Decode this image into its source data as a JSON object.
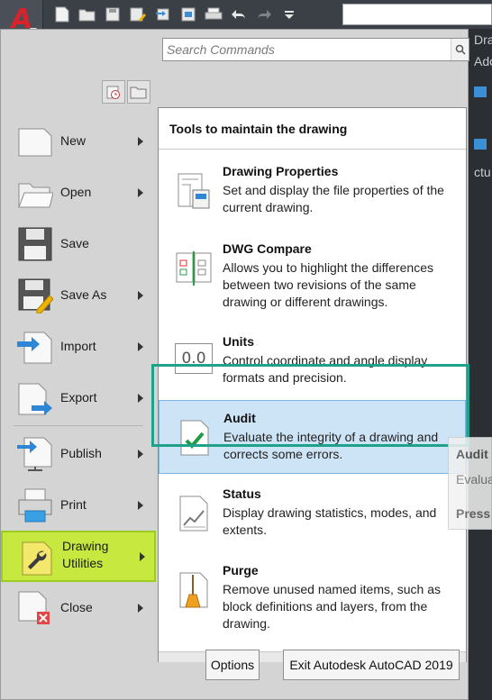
{
  "search": {
    "placeholder": "Search Commands"
  },
  "quick_access": {
    "icons": [
      "new-icon",
      "open-icon",
      "save-icon",
      "save-as-icon",
      "publish-icon",
      "plot-icon",
      "print-icon",
      "undo-icon",
      "redo-icon",
      "customize-icon"
    ]
  },
  "background": {
    "fragments": [
      "Dra",
      "Ado",
      "ctu"
    ]
  },
  "left_menu": [
    {
      "id": "new",
      "label": "New",
      "has_submenu": true,
      "icon": "new-file-icon"
    },
    {
      "id": "open",
      "label": "Open",
      "has_submenu": true,
      "icon": "open-folder-icon"
    },
    {
      "id": "save",
      "label": "Save",
      "has_submenu": false,
      "icon": "save-icon"
    },
    {
      "id": "save-as",
      "label": "Save As",
      "has_submenu": true,
      "icon": "save-as-icon"
    },
    {
      "id": "import",
      "label": "Import",
      "has_submenu": true,
      "icon": "import-icon"
    },
    {
      "id": "export",
      "label": "Export",
      "has_submenu": true,
      "icon": "export-icon"
    },
    {
      "id": "publish",
      "label": "Publish",
      "has_submenu": true,
      "icon": "publish-icon"
    },
    {
      "id": "print",
      "label": "Print",
      "has_submenu": true,
      "icon": "print-icon"
    },
    {
      "id": "drawing-utilities",
      "label_line1": "Drawing",
      "label_line2": "Utilities",
      "has_submenu": true,
      "icon": "wrench-icon",
      "active": true
    },
    {
      "id": "close",
      "label": "Close",
      "has_submenu": true,
      "icon": "close-file-icon"
    }
  ],
  "flyout": {
    "title": "Tools to maintain the drawing",
    "items": [
      {
        "name": "Drawing Properties",
        "desc": "Set and display the file properties of the current drawing.",
        "icon": "drawing-properties-icon"
      },
      {
        "name": "DWG Compare",
        "desc": "Allows you to highlight the differences between two revisions of the same drawing or different drawings.",
        "icon": "dwg-compare-icon"
      },
      {
        "name": "Units",
        "desc": "Control coordinate and angle display formats and precision.",
        "icon": "units-icon",
        "icon_text": "0.0"
      },
      {
        "name": "Audit",
        "desc": "Evaluate the integrity of a drawing and corrects some errors.",
        "icon": "audit-icon",
        "highlighted": true
      },
      {
        "name": "Status",
        "desc": "Display drawing statistics, modes, and extents.",
        "icon": "status-icon"
      },
      {
        "name": "Purge",
        "desc": "Remove unused named items, such as block definitions and layers, from the drawing.",
        "icon": "purge-icon"
      }
    ]
  },
  "tooltip_ghost": {
    "title": "Audit",
    "desc": "Evalua",
    "hint": "Press"
  },
  "buttons": {
    "options": "Options",
    "exit": "Exit Autodesk AutoCAD 2019"
  },
  "colors": {
    "accent_active": "#c7e93f",
    "highlight": "#cde3f6",
    "frame": "#1ea38a",
    "brand": "#d8232a"
  }
}
